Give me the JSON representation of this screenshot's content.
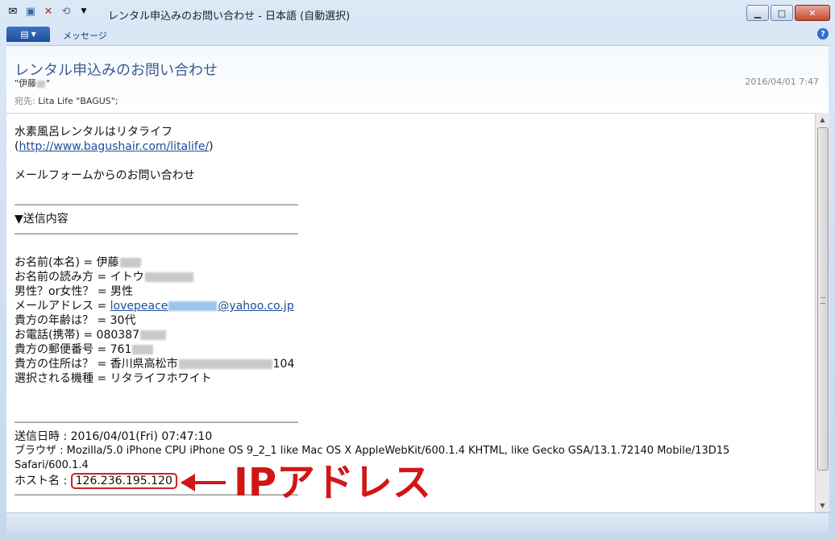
{
  "window": {
    "title": "レンタル申込みのお問い合わせ - 日本語 (自動選択)",
    "controls": {
      "minimize": "▁",
      "maximize": "□",
      "close": "✕"
    }
  },
  "toolbar": {
    "icons": [
      "envelope-icon",
      "save-icon",
      "delete-icon",
      "reply-icon",
      "dropdown-icon"
    ]
  },
  "ribbon": {
    "tab_message": "メッセージ",
    "help_label": "?"
  },
  "header": {
    "subject": "レンタル申込みのお問い合わせ",
    "sender": "\"伊藤",
    "sender_tail": "\"",
    "date": "2016/04/01 7:47",
    "to_label": "宛先:",
    "to_value": "Lita Life \"BAGUS\";"
  },
  "body": {
    "intro_line1": "水素風呂レンタルはリタライフ",
    "intro_paren_open": "(",
    "intro_link": "http://www.bagushair.com/litalife/",
    "intro_paren_close": ")",
    "form_line": "メールフォームからのお問い合わせ",
    "divider": "――――――――――――――――――――――――――――――――",
    "section_title": "▼送信内容",
    "fields": {
      "name": "お名前(本名) = 伊藤",
      "reading": "お名前の読み方 = イトウ",
      "gender": "男性？or女性？ = 男性",
      "email_label": "メールアドレス = ",
      "email_user": "lovepeace",
      "email_domain": "@yahoo.co.jp",
      "age": "貴方の年齢は？ = 30代",
      "phone": "お電話(携帯) = 080387",
      "postal": "貴方の郵便番号 = 761",
      "address": "貴方の住所は？ = 香川県高松市",
      "address_tail": "104",
      "model": "選択される機種 = リタライフホワイト"
    },
    "sent_time": "送信日時 : 2016/04/01(Fri) 07:47:10",
    "browser_line1": "ブラウザ : Mozilla/5.0 iPhone CPU iPhone OS 9_2_1 like Mac OS X AppleWebKit/600.1.4 KHTML, like Gecko GSA/13.1.72140 Mobile/13D15",
    "browser_line2": "Safari/600.1.4",
    "host_label": "ホスト名 : ",
    "host_ip": "126.236.195.120"
  },
  "annotation": {
    "arrow": "←",
    "text": "IPアドレス",
    "color": "#d21616"
  }
}
